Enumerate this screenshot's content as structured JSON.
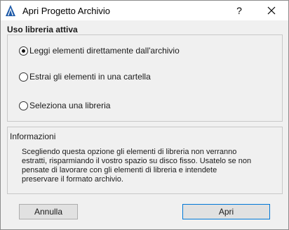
{
  "window": {
    "title": "Apri Progetto Archivio"
  },
  "titlebar": {
    "help_label": "?"
  },
  "library": {
    "section_title": "Uso libreria attiva",
    "options": [
      {
        "label": "Leggi elementi direttamente dall'archivio",
        "checked": true
      },
      {
        "label": "Estrai gli elementi in una cartella",
        "checked": false
      },
      {
        "label": "Seleziona una libreria",
        "checked": false
      }
    ]
  },
  "info": {
    "title": "Informazioni",
    "lines": [
      "Scegliendo questa opzione gli elementi di libreria non verranno",
      "estratti, risparmiando il vostro spazio su disco fisso. Usatelo se non",
      "pensate di lavorare con gli elementi di libreria e intendete",
      "preservare il formato archivio."
    ]
  },
  "buttons": {
    "cancel_label": "Annulla",
    "open_label": "Apri"
  }
}
